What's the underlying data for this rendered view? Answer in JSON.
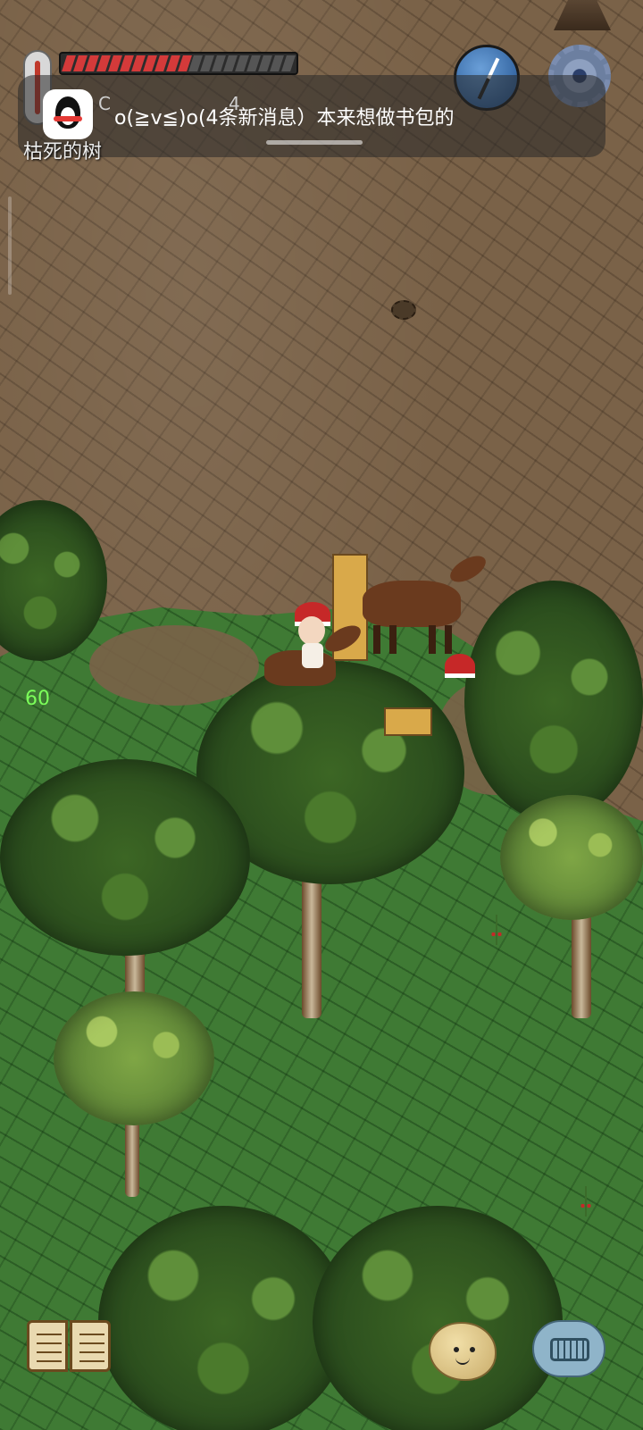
{
  "hud": {
    "notification_text": "o(≧v≦)o(4条新消息）本来想做书包的",
    "temperature_partial": "C",
    "partial_number": "4",
    "object_label": "枯死的树",
    "fps": "60",
    "food_pips_total": 20,
    "food_pips_full": 11,
    "colors": {
      "food_full": "#d43a3a",
      "grass": "#3f7a34",
      "dirt": "#7a6248"
    }
  },
  "icons": {
    "thermometer": "thermometer-icon",
    "compass": "compass-icon",
    "settings": "gear-icon",
    "qq": "qq-penguin-icon",
    "tech_book": "book-icon",
    "emote": "potato-face-icon",
    "chat": "keyboard-icon"
  }
}
